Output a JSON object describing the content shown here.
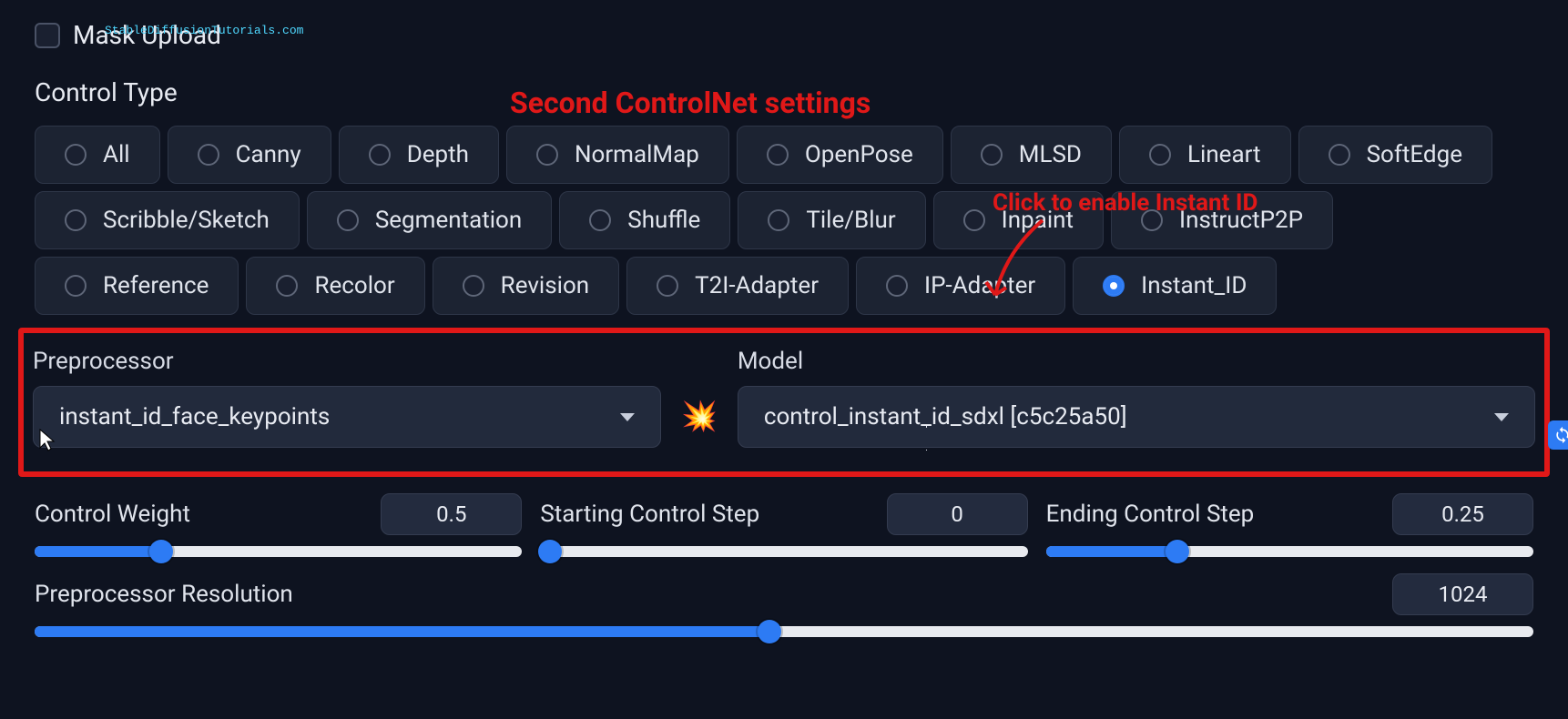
{
  "watermark": "StableDiffusionTutorials.com",
  "mask_upload_label": "Mask Upload",
  "control_type_label": "Control Type",
  "annotations": {
    "title": "Second ControlNet settings",
    "enable": "Click to enable Instant ID"
  },
  "control_types": [
    {
      "label": "All",
      "selected": false
    },
    {
      "label": "Canny",
      "selected": false
    },
    {
      "label": "Depth",
      "selected": false
    },
    {
      "label": "NormalMap",
      "selected": false
    },
    {
      "label": "OpenPose",
      "selected": false
    },
    {
      "label": "MLSD",
      "selected": false
    },
    {
      "label": "Lineart",
      "selected": false
    },
    {
      "label": "SoftEdge",
      "selected": false
    },
    {
      "label": "Scribble/Sketch",
      "selected": false
    },
    {
      "label": "Segmentation",
      "selected": false
    },
    {
      "label": "Shuffle",
      "selected": false
    },
    {
      "label": "Tile/Blur",
      "selected": false
    },
    {
      "label": "Inpaint",
      "selected": false
    },
    {
      "label": "InstructP2P",
      "selected": false
    },
    {
      "label": "Reference",
      "selected": false
    },
    {
      "label": "Recolor",
      "selected": false
    },
    {
      "label": "Revision",
      "selected": false
    },
    {
      "label": "T2I-Adapter",
      "selected": false
    },
    {
      "label": "IP-Adapter",
      "selected": false
    },
    {
      "label": "Instant_ID",
      "selected": true
    }
  ],
  "preprocessor": {
    "label": "Preprocessor",
    "value": "instant_id_face_keypoints"
  },
  "model": {
    "label": "Model",
    "value": "control_instant_id_sdxl [c5c25a50]"
  },
  "sliders": {
    "control_weight": {
      "label": "Control Weight",
      "value": "0.5",
      "fill_pct": 26
    },
    "starting_step": {
      "label": "Starting Control Step",
      "value": "0",
      "fill_pct": 2
    },
    "ending_step": {
      "label": "Ending Control Step",
      "value": "0.25",
      "fill_pct": 27
    },
    "preproc_res": {
      "label": "Preprocessor Resolution",
      "value": "1024",
      "fill_pct": 49
    }
  }
}
